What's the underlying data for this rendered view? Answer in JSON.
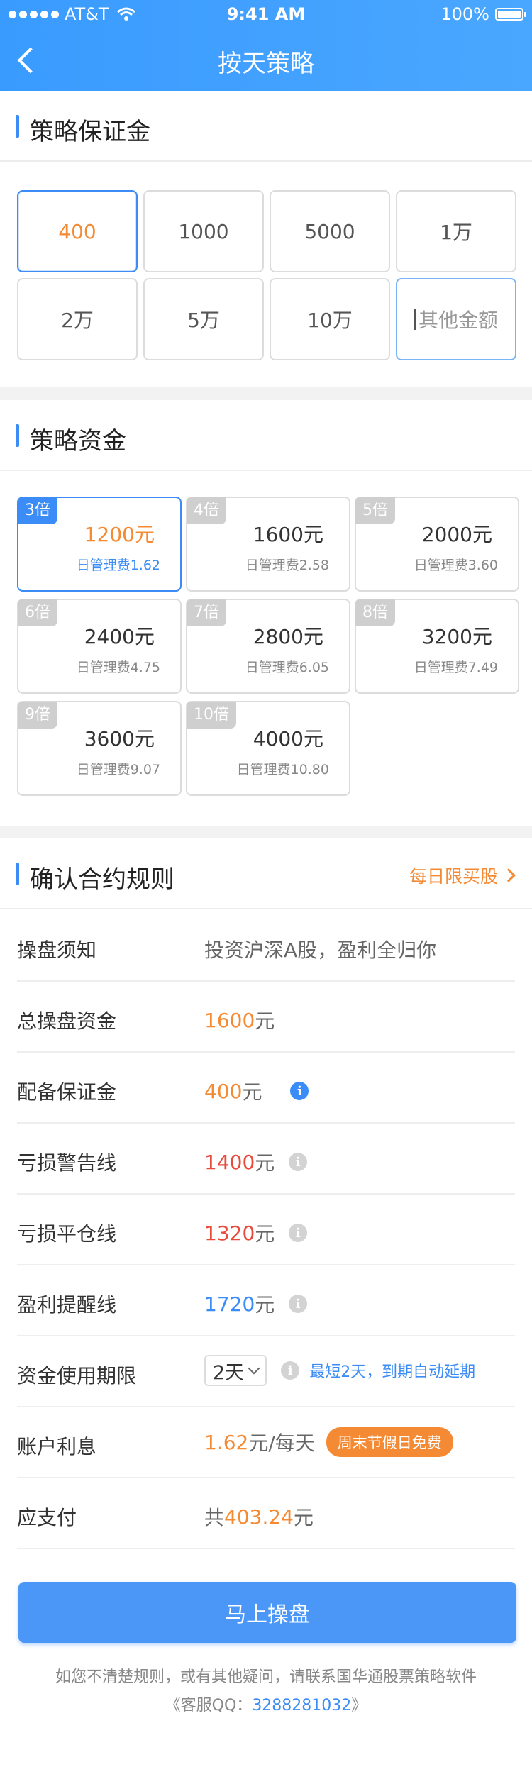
{
  "status_bar": {
    "carrier": "AT&T",
    "time": "9:41 AM",
    "battery": "100%"
  },
  "nav": {
    "title": "按天策略"
  },
  "deposit": {
    "title": "策略保证金",
    "options": [
      "400",
      "1000",
      "5000",
      "1万",
      "2万",
      "5万",
      "10万"
    ],
    "selected": "400",
    "custom_placeholder": "其他金额"
  },
  "capital": {
    "title": "策略资金",
    "options": [
      {
        "multiple": "3倍",
        "amount": "1200元",
        "fee": "日管理费1.62",
        "selected": true
      },
      {
        "multiple": "4倍",
        "amount": "1600元",
        "fee": "日管理费2.58"
      },
      {
        "multiple": "5倍",
        "amount": "2000元",
        "fee": "日管理费3.60"
      },
      {
        "multiple": "6倍",
        "amount": "2400元",
        "fee": "日管理费4.75"
      },
      {
        "multiple": "7倍",
        "amount": "2800元",
        "fee": "日管理费6.05"
      },
      {
        "multiple": "8倍",
        "amount": "3200元",
        "fee": "日管理费7.49"
      },
      {
        "multiple": "9倍",
        "amount": "3600元",
        "fee": "日管理费9.07"
      },
      {
        "multiple": "10倍",
        "amount": "4000元",
        "fee": "日管理费10.80"
      }
    ]
  },
  "rules": {
    "title": "确认合约规则",
    "link": "每日限买股",
    "notice": {
      "label": "操盘须知",
      "text": "投资沪深A股，盈利全归你"
    },
    "total": {
      "label": "总操盘资金",
      "value": "1600",
      "unit": "元"
    },
    "deposit": {
      "label": "配备保证金",
      "value": "400",
      "unit": "元"
    },
    "warning": {
      "label": "亏损警告线",
      "value": "1400",
      "unit": "元"
    },
    "closeout": {
      "label": "亏损平仓线",
      "value": "1320",
      "unit": "元"
    },
    "profit": {
      "label": "盈利提醒线",
      "value": "1720",
      "unit": "元"
    },
    "term": {
      "label": "资金使用期限",
      "value": "2天",
      "hint": "最短2天，到期自动延期"
    },
    "interest": {
      "label": "账户利息",
      "value": "1.62",
      "unit": "元/每天",
      "badge": "周末节假日免费"
    },
    "payable": {
      "label": "应支付",
      "prefix": "共",
      "value": "403.24",
      "unit": "元"
    }
  },
  "submit_label": "马上操盘",
  "footer": {
    "line1": "如您不清楚规则，或有其他疑问，请联系国华通股票策略软件",
    "qq_prefix": "《客服QQ：",
    "qq": "3288281032",
    "qq_suffix": "》"
  },
  "colors": {
    "accent": "#3b8cf6",
    "highlight": "#f48b34",
    "danger": "#e84a3b"
  }
}
